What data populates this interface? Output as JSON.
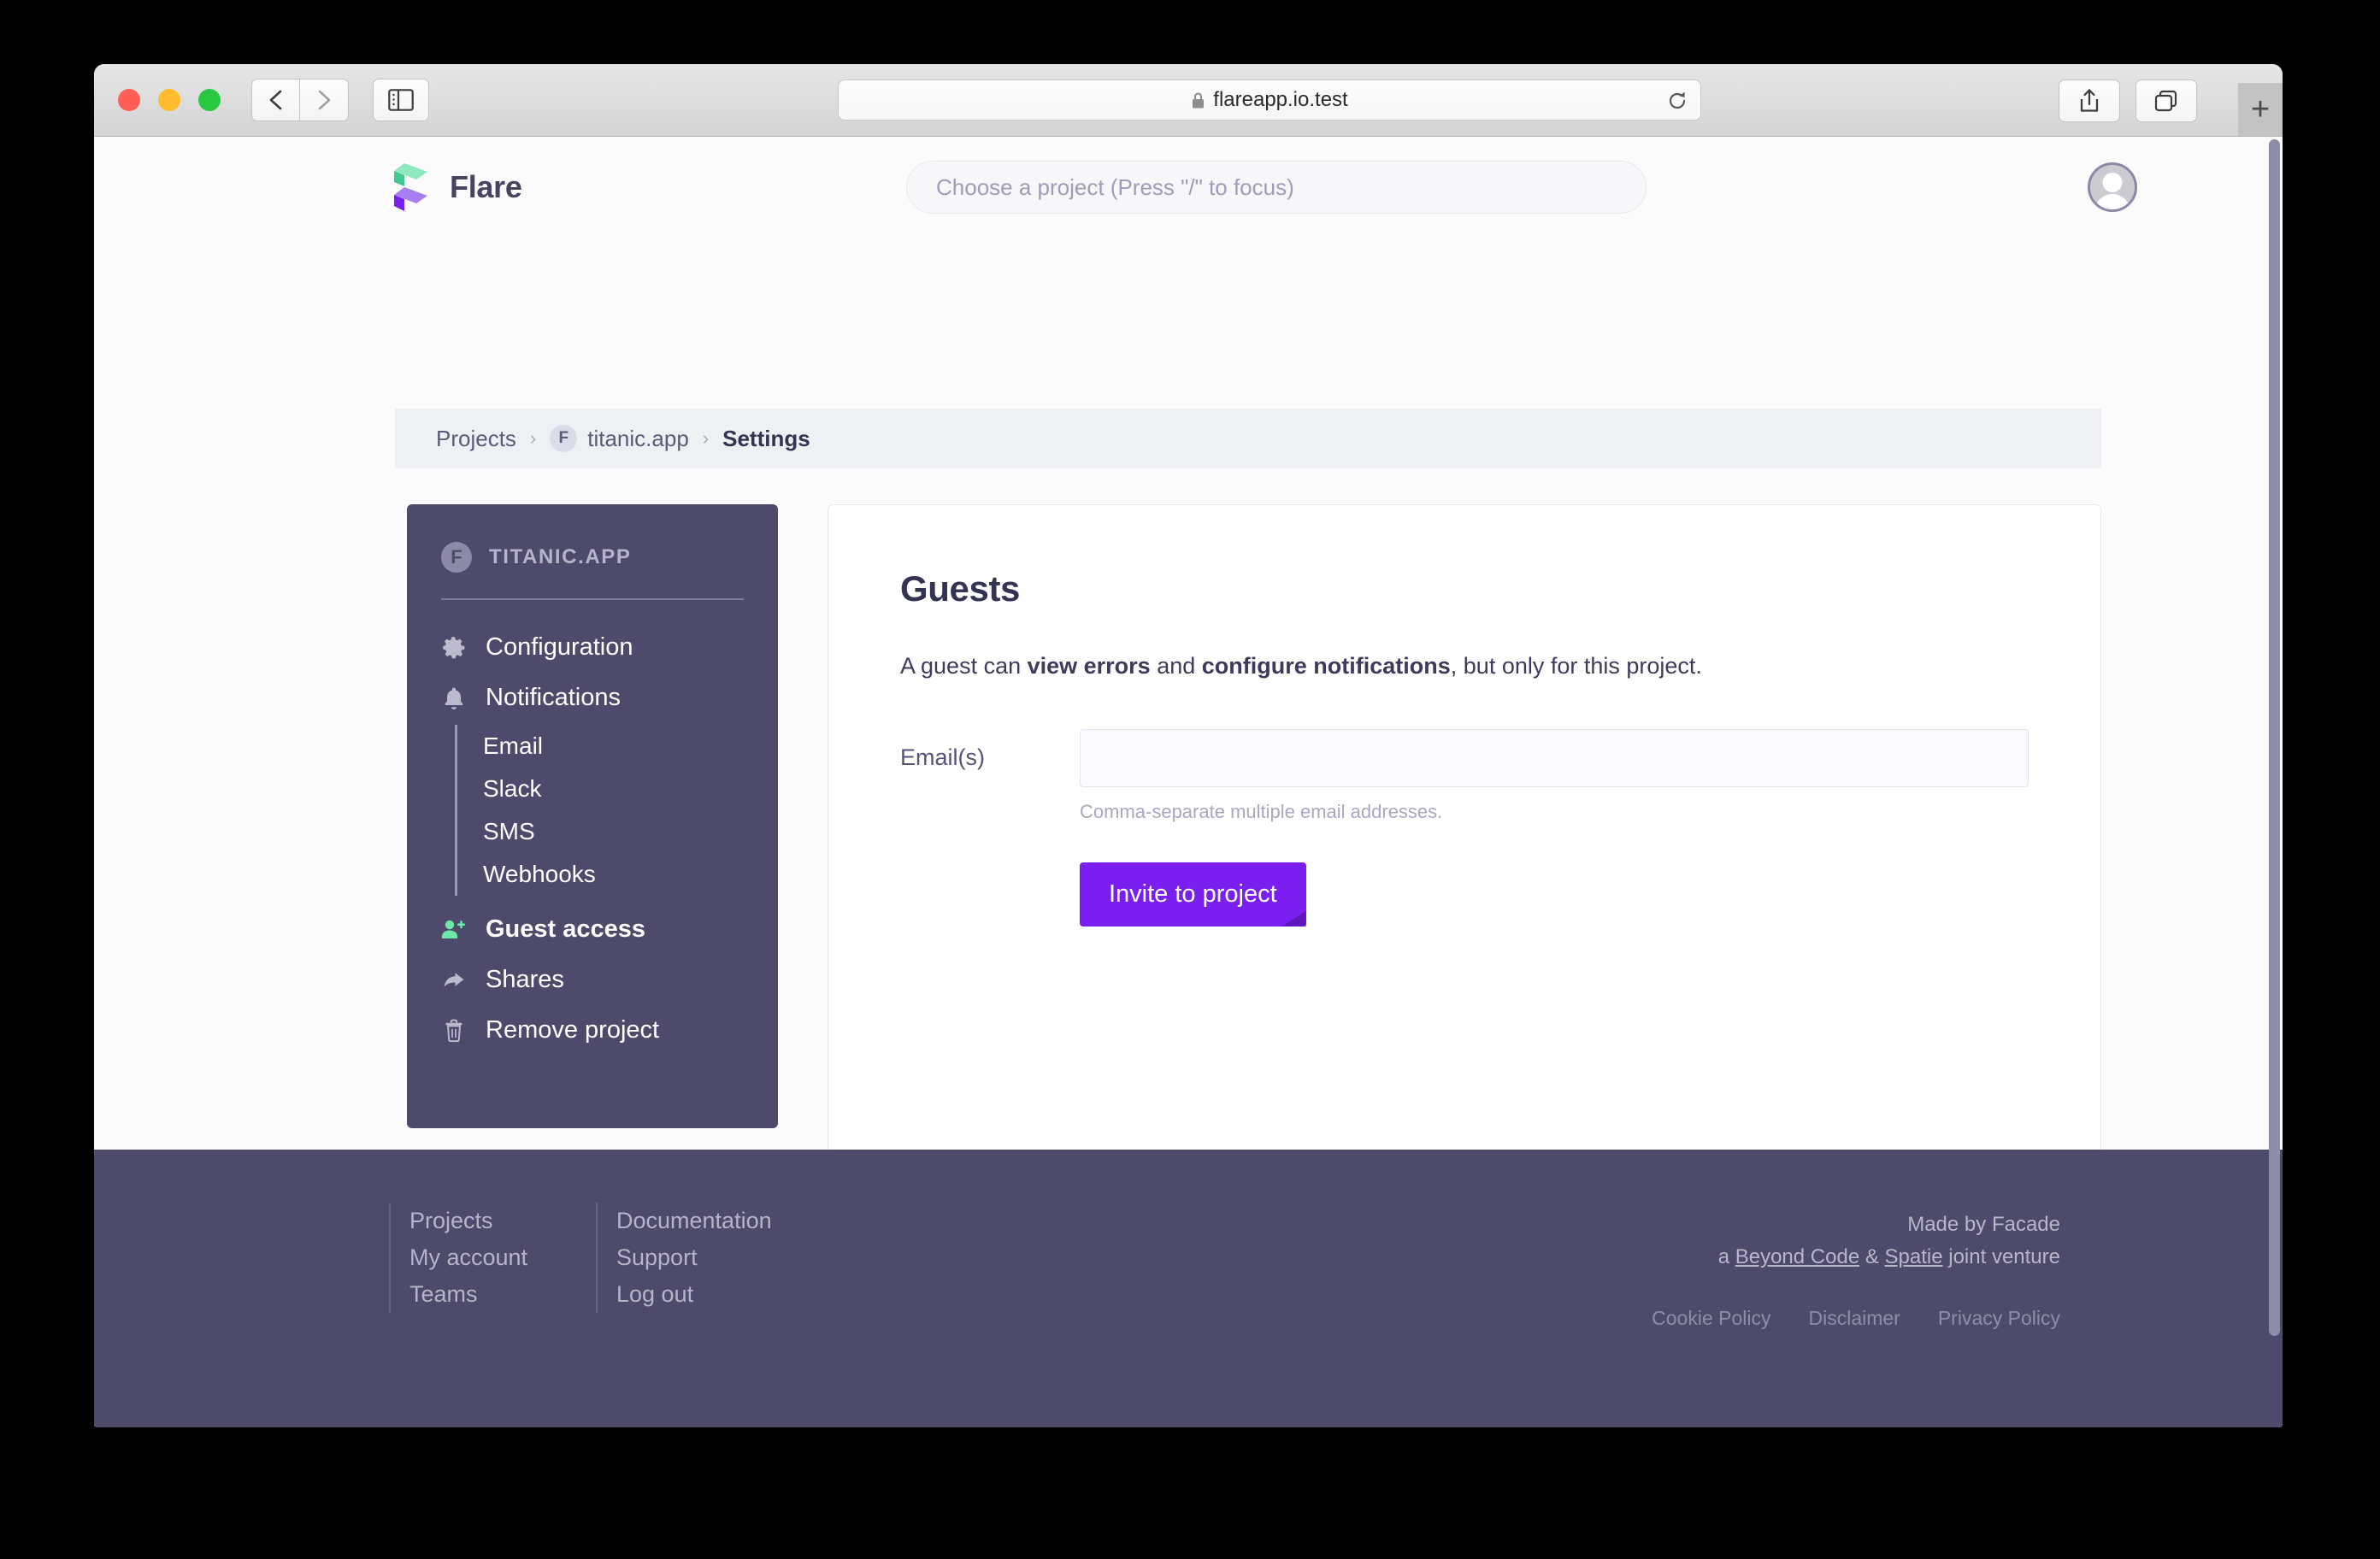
{
  "browser": {
    "url": "flareapp.io.test",
    "lock_icon": "lock-icon",
    "back_icon": "chevron-left-icon",
    "forward_icon": "chevron-right-icon",
    "sidebar_icon": "sidebar-toggle-icon",
    "reload_icon": "reload-icon",
    "share_icon": "share-icon",
    "tabs_icon": "tab-overview-icon",
    "newtab_label": "+"
  },
  "header": {
    "brand": "Flare",
    "search_placeholder": "Choose a project (Press \"/\" to focus)",
    "search_value": "",
    "avatar_name": "user-avatar"
  },
  "breadcrumb": {
    "projects": "Projects",
    "sep": "›",
    "project_badge": "F",
    "project": "titanic.app",
    "current": "Settings"
  },
  "sidebar": {
    "project_badge": "F",
    "project_name": "TITANIC.APP",
    "items": [
      {
        "label": "Configuration",
        "icon": "gear-icon",
        "active": false
      },
      {
        "label": "Notifications",
        "icon": "bell-icon",
        "active": false
      },
      {
        "label": "Guest access",
        "icon": "user-plus-icon",
        "active": true
      },
      {
        "label": "Shares",
        "icon": "share-arrow-icon",
        "active": false
      },
      {
        "label": "Remove project",
        "icon": "trash-icon",
        "active": false
      }
    ],
    "subitems": [
      {
        "label": "Email"
      },
      {
        "label": "Slack"
      },
      {
        "label": "SMS"
      },
      {
        "label": "Webhooks"
      }
    ]
  },
  "main": {
    "title": "Guests",
    "desc_part1": "A guest can ",
    "desc_bold1": "view errors",
    "desc_part2": " and ",
    "desc_bold2": "configure notifications",
    "desc_part3": ", but only for this project.",
    "email_label": "Email(s)",
    "email_value": "",
    "email_placeholder": "",
    "email_hint": "Comma-separate multiple email addresses.",
    "invite_button": "Invite to project"
  },
  "footer": {
    "col1": [
      "Projects",
      "My account",
      "Teams"
    ],
    "col2": [
      "Documentation",
      "Support",
      "Log out"
    ],
    "made_by": "Made by Facade",
    "venture_prefix": "a ",
    "venture_link1": "Beyond Code",
    "venture_amp": " & ",
    "venture_link2": "Spatie",
    "venture_suffix": " joint venture",
    "policies": [
      "Cookie Policy",
      "Disclaimer",
      "Privacy Policy"
    ]
  },
  "colors": {
    "brand_purple": "#7a1ff0",
    "sidebar_bg": "#4d4a6b",
    "accent_green": "#6ee7a8",
    "text_dark": "#353353"
  }
}
